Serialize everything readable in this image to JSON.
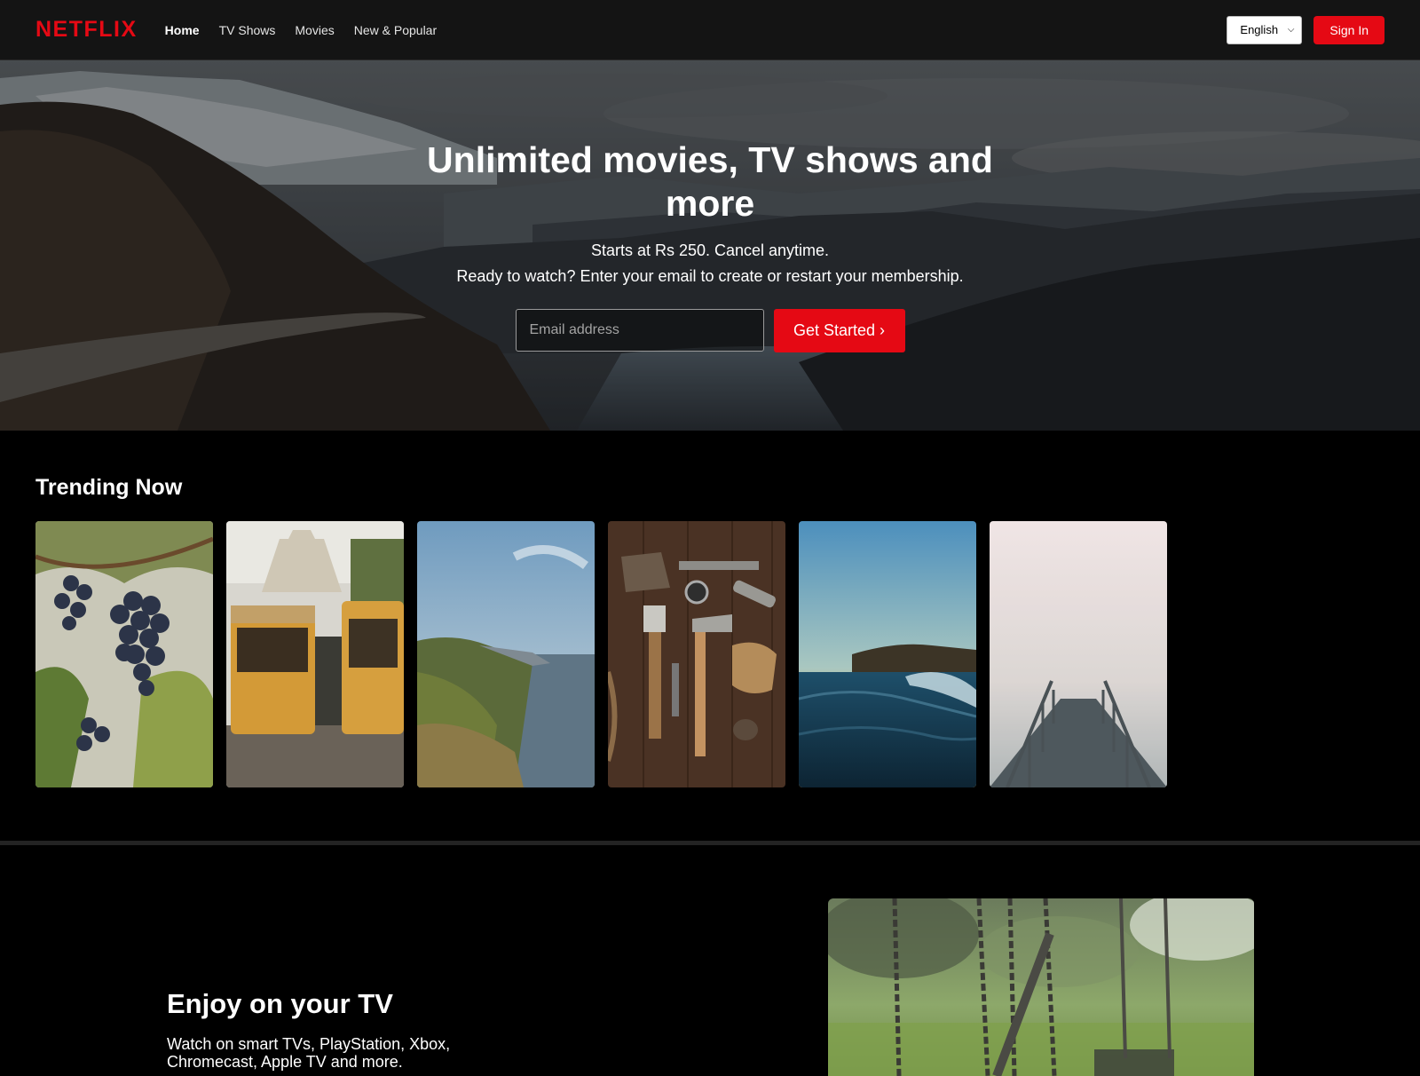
{
  "header": {
    "logo": "NETFLIX",
    "nav": [
      "Home",
      "TV Shows",
      "Movies",
      "New & Popular"
    ],
    "language": "English",
    "signin_label": "Sign In"
  },
  "hero": {
    "title": "Unlimited movies, TV shows and more",
    "subtitle": "Starts at Rs 250. Cancel anytime.",
    "prompt": "Ready to watch? Enter your email to create or restart your membership.",
    "email_placeholder": "Email address",
    "cta_label": "Get Started ›"
  },
  "trending": {
    "title": "Trending Now"
  },
  "feature": {
    "title": "Enjoy on your TV",
    "text": "Watch on smart TVs, PlayStation, Xbox, Chromecast, Apple TV and more."
  },
  "colors": {
    "brand_red": "#e50914",
    "header_bg": "#141414",
    "page_bg": "#000000"
  }
}
